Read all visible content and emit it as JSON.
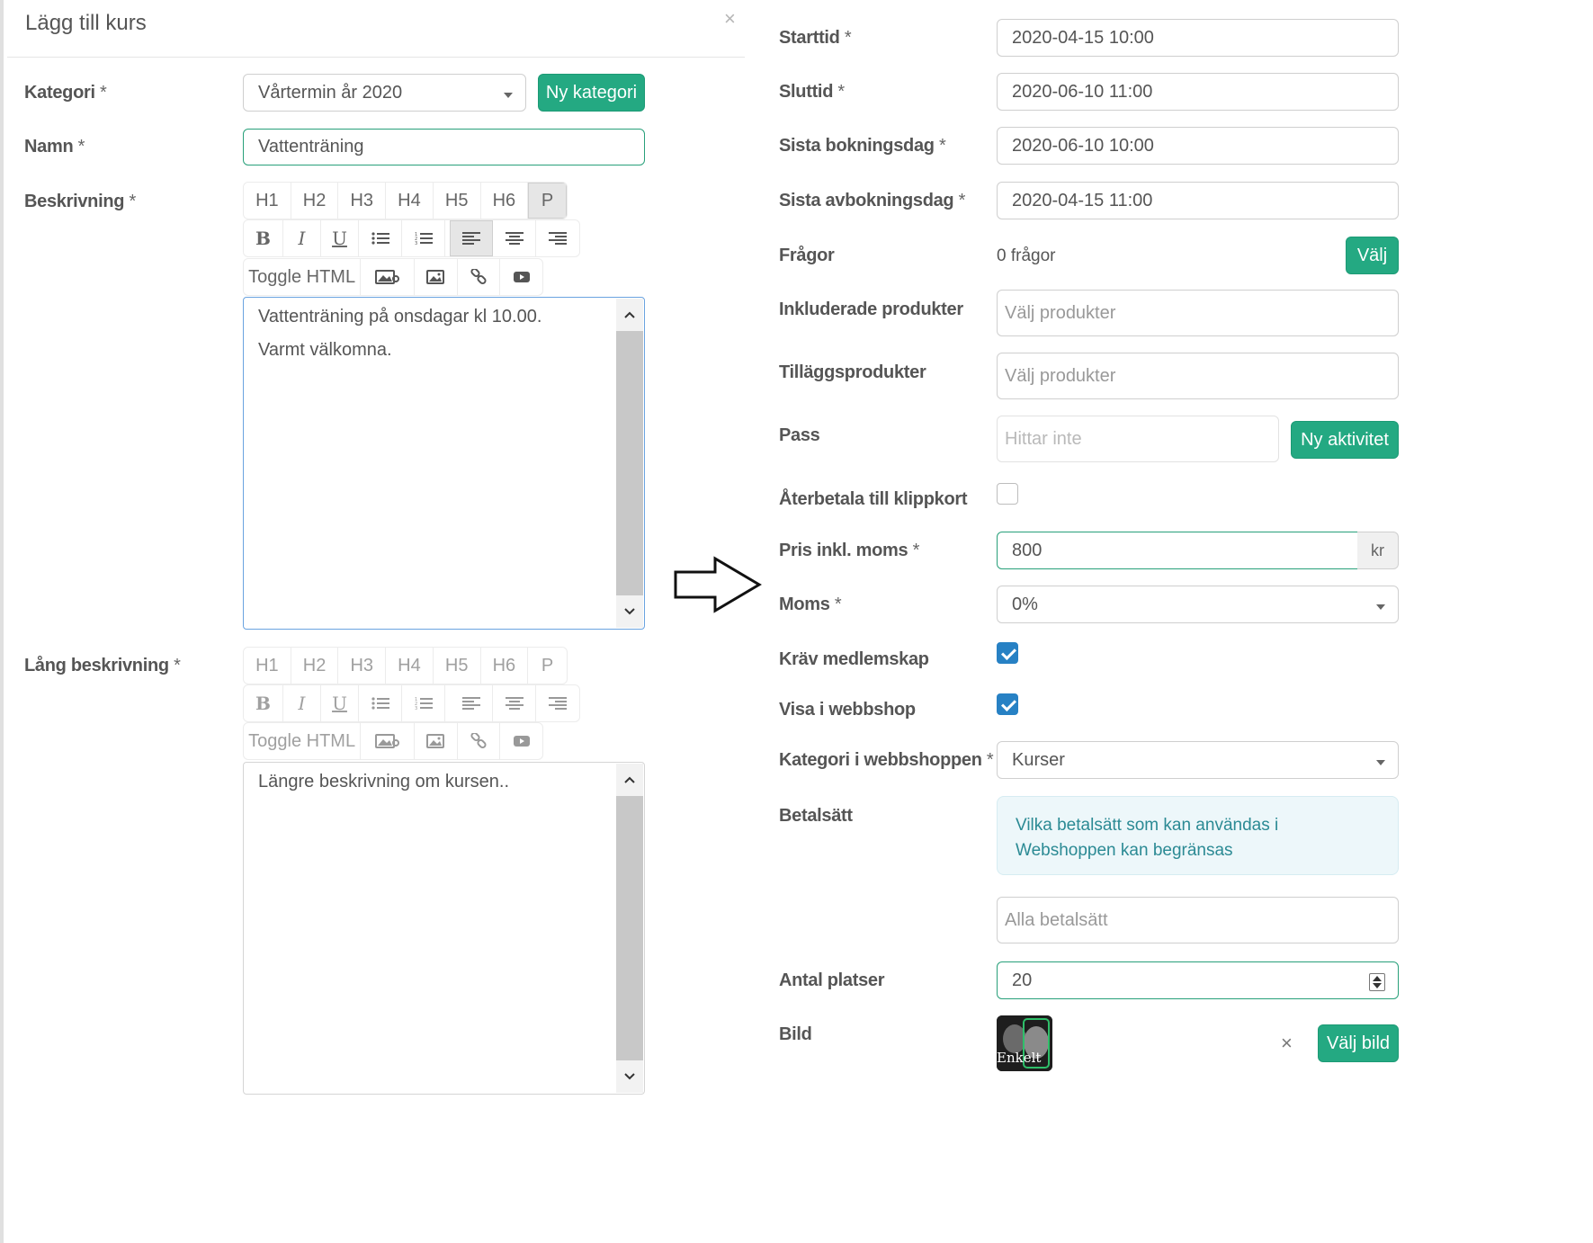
{
  "modal": {
    "title": "Lägg till kurs",
    "close": "×"
  },
  "left_form": {
    "kategori": {
      "label": "Kategori",
      "required": "*",
      "value": "Vårtermin år 2020",
      "new_button": "Ny kategori"
    },
    "namn": {
      "label": "Namn",
      "required": "*",
      "value": "Vattenträning"
    },
    "beskrivning": {
      "label": "Beskrivning",
      "required": "*",
      "lines": [
        "Vattenträning på onsdagar kl 10.00.",
        "Varmt välkomna."
      ]
    },
    "lang_beskrivning": {
      "label": "Lång beskrivning",
      "required": "*",
      "text": "Längre beskrivning om kursen.."
    },
    "toolbar": {
      "headings": [
        "H1",
        "H2",
        "H3",
        "H4",
        "H5",
        "H6",
        "P"
      ],
      "bold": "B",
      "italic": "I",
      "underline": "U",
      "toggle_html": "Toggle HTML"
    }
  },
  "right_form": {
    "starttid": {
      "label": "Starttid",
      "required": "*",
      "value": "2020-04-15 10:00"
    },
    "sluttid": {
      "label": "Sluttid",
      "required": "*",
      "value": "2020-06-10 11:00"
    },
    "sista_bokningsdag": {
      "label": "Sista bokningsdag",
      "required": "*",
      "value": "2020-06-10 10:00"
    },
    "sista_avbokningsdag": {
      "label": "Sista avbokningsdag",
      "required": "*",
      "value": "2020-04-15 11:00"
    },
    "fragor": {
      "label": "Frågor",
      "value": "0 frågor",
      "button": "Välj"
    },
    "inkluderade_produkter": {
      "label": "Inkluderade produkter",
      "placeholder": "Välj produkter"
    },
    "tillaggsprodukter": {
      "label": "Tilläggsprodukter",
      "placeholder": "Välj produkter"
    },
    "pass": {
      "label": "Pass",
      "placeholder": "Hittar inte",
      "button": "Ny aktivitet"
    },
    "aterbetala": {
      "label": "Återbetala till klippkort",
      "checked": false
    },
    "pris": {
      "label": "Pris inkl. moms",
      "required": "*",
      "value": "800",
      "addon": "kr"
    },
    "moms": {
      "label": "Moms",
      "required": "*",
      "value": "0%"
    },
    "krav_medlemskap": {
      "label": "Kräv medlemskap",
      "checked": true
    },
    "visa_webbshop": {
      "label": "Visa i webbshop",
      "checked": true
    },
    "kategori_webbshop": {
      "label": "Kategori i webbshoppen",
      "required": "*",
      "value": "Kurser"
    },
    "betalsatt": {
      "label": "Betalsätt",
      "info": "Vilka betalsätt som kan användas i Webshoppen kan begränsas",
      "placeholder": "Alla betalsätt"
    },
    "antal_platser": {
      "label": "Antal platser",
      "value": "20"
    },
    "bild": {
      "label": "Bild",
      "thumbnail_text": "Enkelt",
      "remove": "×",
      "button": "Välj bild"
    }
  },
  "colors": {
    "accent_green": "#24a982",
    "checkbox_blue": "#2781c4",
    "info_text": "#2b8a94"
  }
}
